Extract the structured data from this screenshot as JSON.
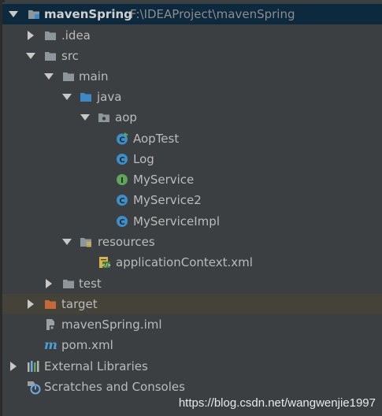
{
  "tree": {
    "project": {
      "name": "mavenSpring",
      "path": "F:\\IDEAProject\\mavenSpring"
    },
    "idea": ".idea",
    "src": "src",
    "main": "main",
    "java": "java",
    "aop": "aop",
    "classes": {
      "aoptest": "AopTest",
      "log": "Log",
      "myservice": "MyService",
      "myservice2": "MyService2",
      "myserviceimpl": "MyServiceImpl"
    },
    "resources": "resources",
    "appcontext": "applicationContext.xml",
    "test": "test",
    "target": "target",
    "iml": "mavenSpring.iml",
    "pom": "pom.xml",
    "external_libraries": "External Libraries",
    "scratches": "Scratches and Consoles"
  },
  "watermark": "https://blog.csdn.net/wangwenjie1997",
  "colors": {
    "background": "#3c3f41",
    "selection": "#0d293e",
    "excluded_row": "#45423a",
    "folder": "#8c969b",
    "source_folder": "#3d88c7",
    "excluded_folder": "#c5693a",
    "class_icon": "#3d8fc5",
    "interface_icon": "#62a55a"
  }
}
